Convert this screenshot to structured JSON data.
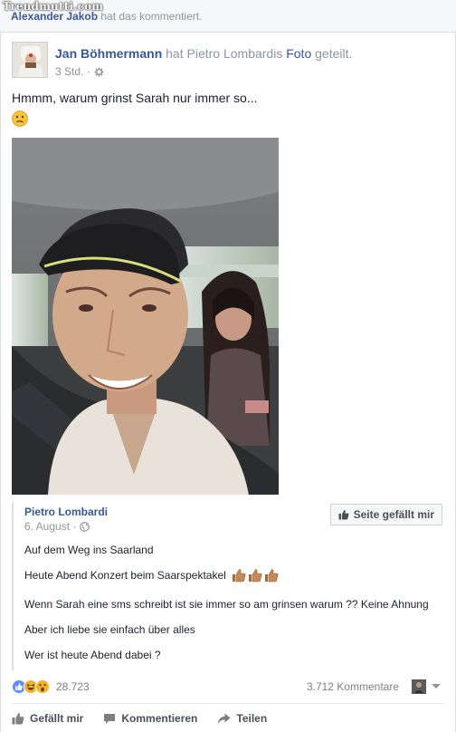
{
  "watermark": "Trendmutti.com",
  "notice": {
    "name": "Alexander Jakob",
    "text": " hat das kommentiert."
  },
  "post": {
    "actor": "Jan Böhmermann",
    "action_text": " hat Pietro Lombardis ",
    "object_link": "Foto",
    "action_end": " geteilt.",
    "time": "3 Std. ·",
    "text": "Hmmm, warum grinst Sarah nur immer so...",
    "emoji_icon": "confused-face-icon"
  },
  "shared": {
    "name": "Pietro Lombardi",
    "date": "6. August ·",
    "like_page_label": "Seite gefällt mir",
    "lines": [
      "Auf dem Weg ins Saarland",
      "Heute Abend Konzert beim Saarspektakel",
      "Wenn Sarah eine sms schreibt ist sie immer so am grinsen warum ?? Keine Ahnung",
      "Aber ich liebe sie einfach über alles",
      "Wer ist heute Abend dabei ?"
    ]
  },
  "stats": {
    "reactions_count": "28.723",
    "comments_count": "3.712 Kommentare"
  },
  "actions": {
    "like": "Gefällt mir",
    "comment": "Kommentieren",
    "share": "Teilen"
  },
  "colors": {
    "link": "#365899",
    "muted": "#90949c",
    "like_blue": "#5890ff",
    "haha_yellow": "#f7b125"
  }
}
